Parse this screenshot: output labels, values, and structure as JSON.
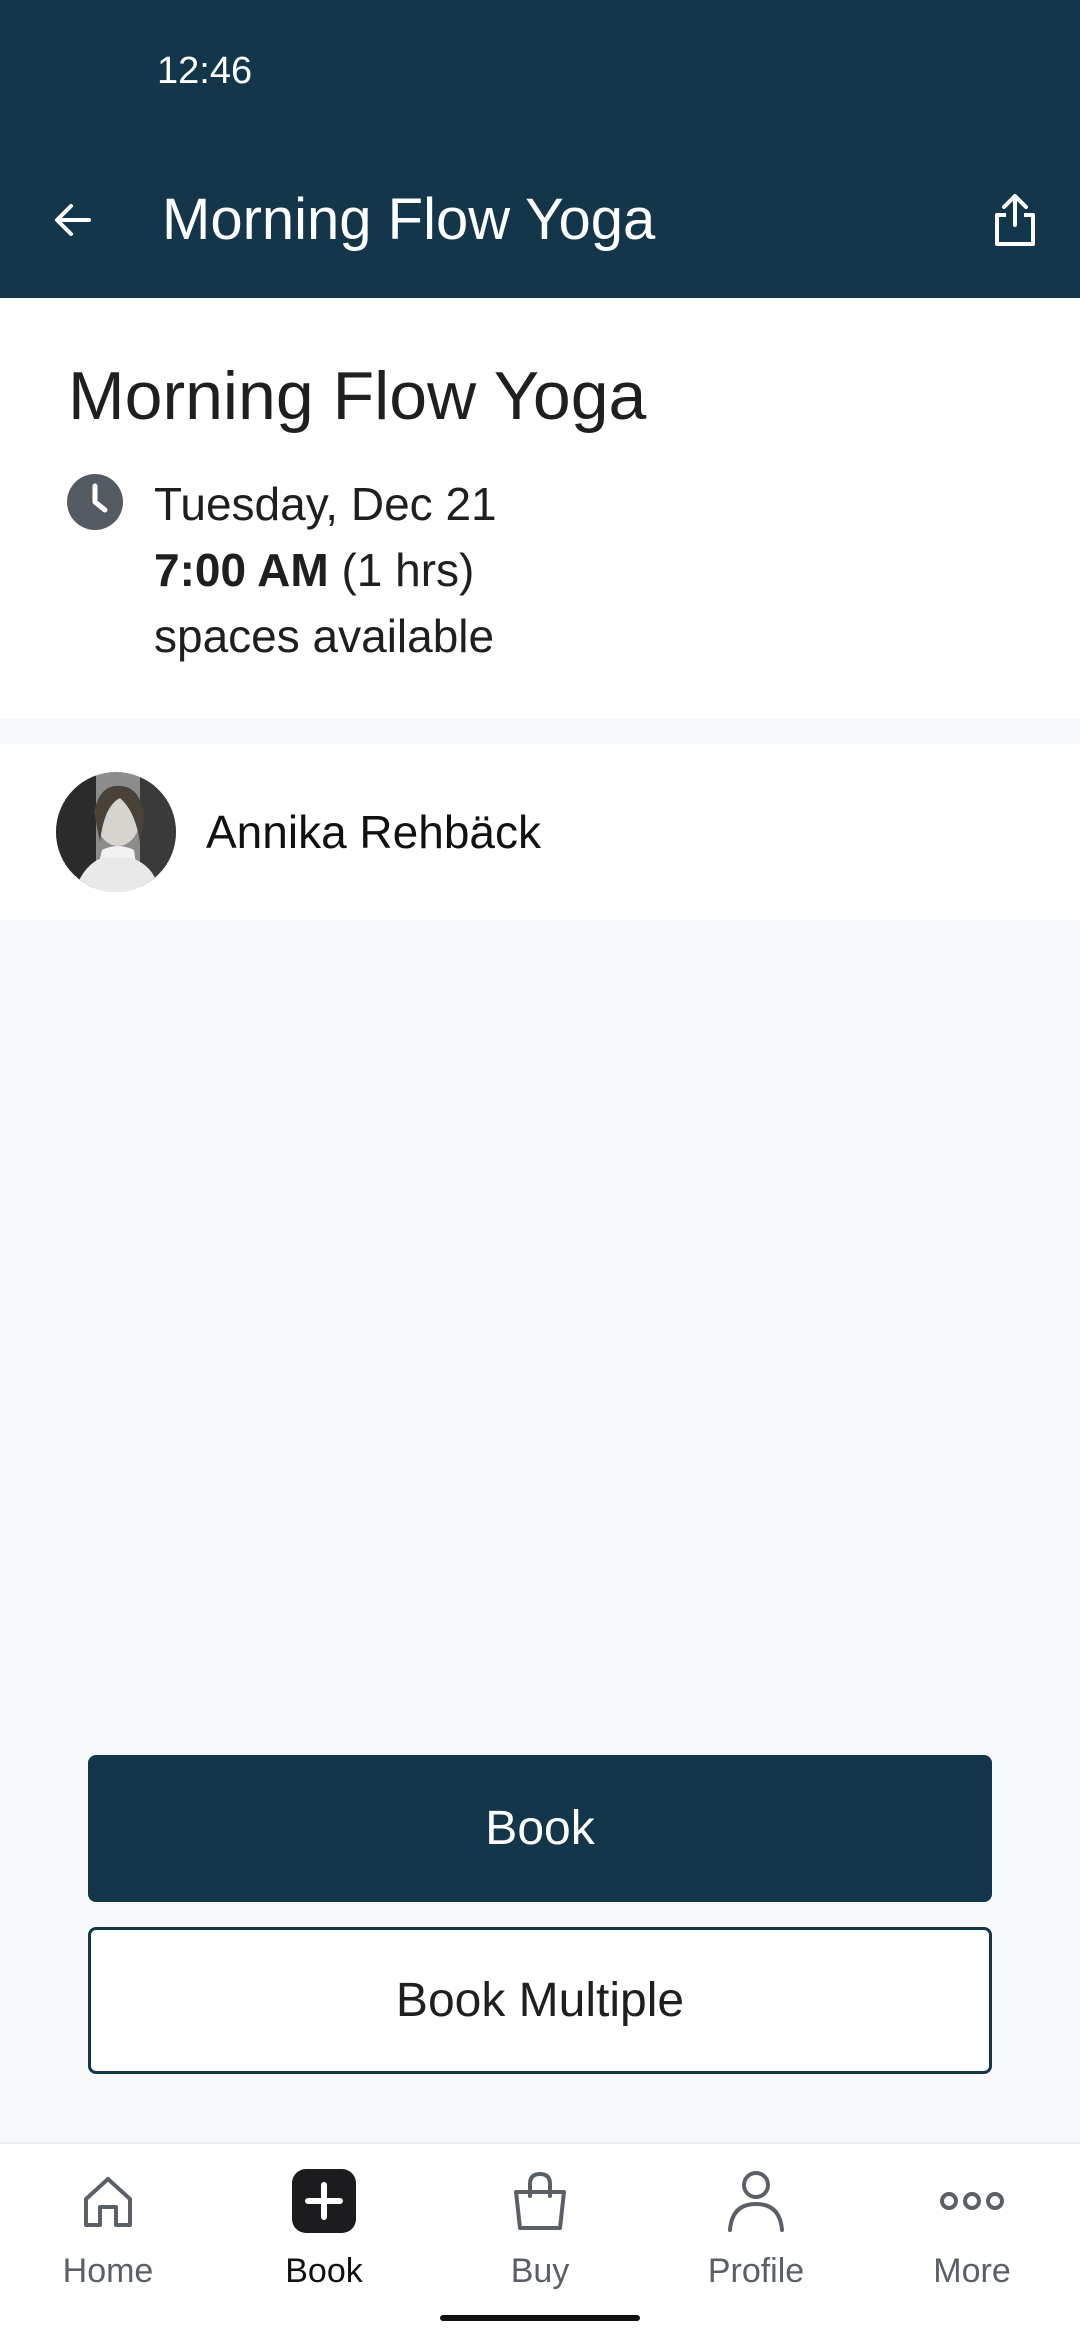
{
  "status_bar": {
    "time": "12:46"
  },
  "header": {
    "title": "Morning Flow Yoga",
    "back_icon": "arrow-left-icon",
    "share_icon": "share-icon"
  },
  "class_info": {
    "title": "Morning Flow Yoga",
    "date": "Tuesday, Dec 21",
    "time": "7:00 AM",
    "duration": " (1 hrs)",
    "spaces": "spaces available"
  },
  "instructor": {
    "name": "Annika Rehbäck"
  },
  "actions": {
    "book_label": "Book",
    "book_multiple_label": "Book Multiple"
  },
  "bottom_nav": {
    "items": [
      {
        "label": "Home",
        "icon": "home-icon"
      },
      {
        "label": "Book",
        "icon": "plus-icon",
        "active": true
      },
      {
        "label": "Buy",
        "icon": "shopping-bag-icon"
      },
      {
        "label": "Profile",
        "icon": "person-icon"
      },
      {
        "label": "More",
        "icon": "more-dots-icon"
      }
    ]
  },
  "colors": {
    "header_bg": "#13364b",
    "primary_button": "#13364b",
    "page_bg": "#f7f8fa"
  }
}
